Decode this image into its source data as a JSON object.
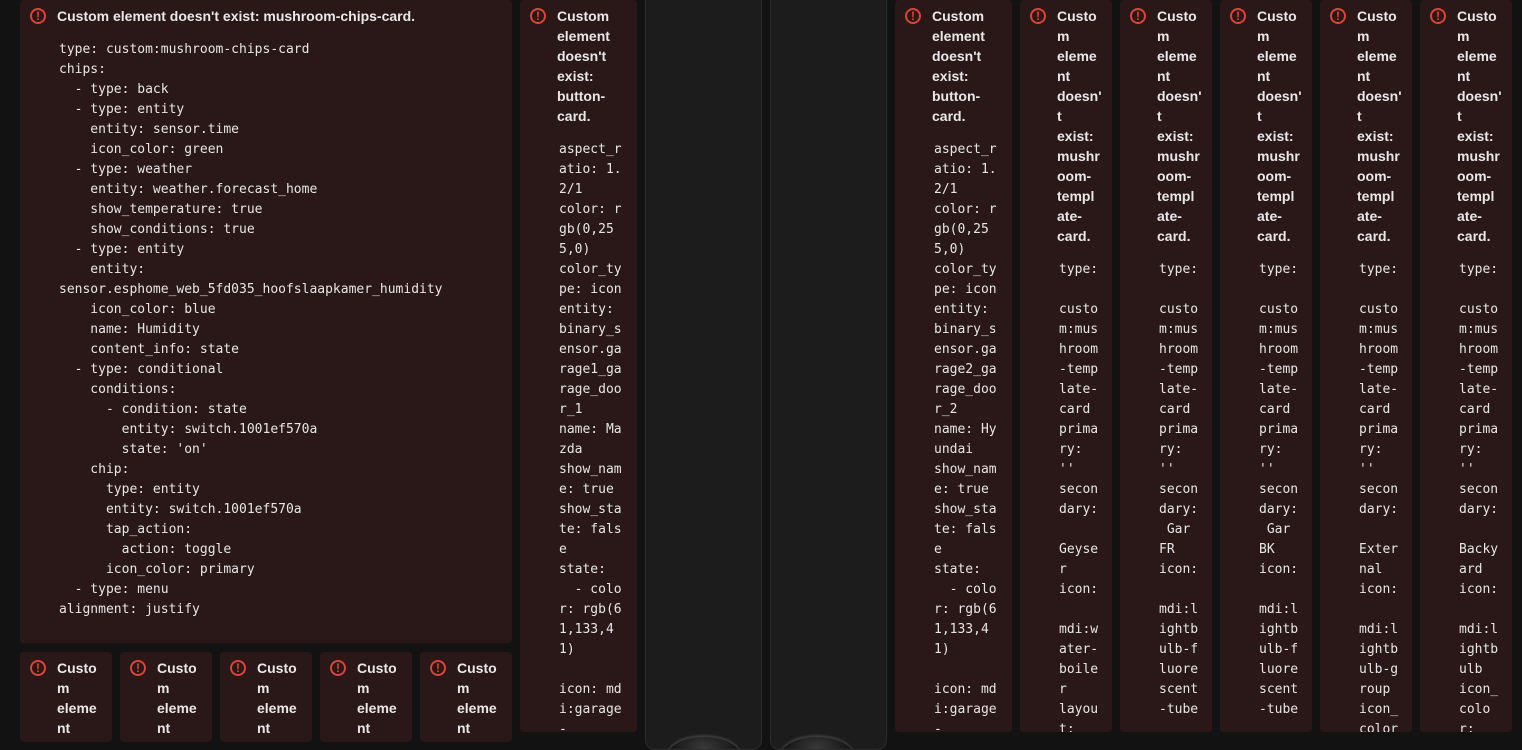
{
  "icons": {
    "error": "error-circle-icon",
    "error_glyph": "!"
  },
  "colors": {
    "background": "#121212",
    "card_bg": "#2a1818",
    "error_red": "#db4437",
    "text": "#e6e6e6"
  },
  "main_card": {
    "title": "Custom element doesn't exist: mushroom-chips-card.",
    "code": "type: custom:mushroom-chips-card\nchips:\n  - type: back\n  - type: entity\n    entity: sensor.time\n    icon_color: green\n  - type: weather\n    entity: weather.forecast_home\n    show_temperature: true\n    show_conditions: true\n  - type: entity\n    entity:\nsensor.esphome_web_5fd035_hoofslaapkamer_humidity\n    icon_color: blue\n    name: Humidity\n    content_info: state\n  - type: conditional\n    conditions:\n      - condition: state\n        entity: switch.1001ef570a\n        state: 'on'\n    chip:\n      type: entity\n      entity: switch.1001ef570a\n      tap_action:\n        action: toggle\n      icon_color: primary\n  - type: menu\nalignment: justify"
  },
  "button_card_1": {
    "title": "Custom element doesn't exist: button-card.",
    "code": "aspect_ratio: 1.2/1\ncolor: rgb(0,255,0)\ncolor_type: icon\nentity: binary_sensor.garage1_garage_door_1\nname: Mazda\nshow_name: true\nshow_state: false\nstate:\n  - color: rgb(61,133,41)\n\nicon: mdi:garage-"
  },
  "button_card_2": {
    "title": "Custom element doesn't exist: button-card.",
    "code": "aspect_ratio: 1.2/1\ncolor: rgb(0,255,0)\ncolor_type: icon\nentity: binary_sensor.garage2_garage_door_2\nname: Hyundai\nshow_name: true\nshow_state: false\nstate:\n  - color: rgb(61,133,41)\n\nicon: mdi:garage-"
  },
  "template_cards": [
    {
      "title": "Custom element doesn't exist: mushroom-template-card.",
      "code": "type:\n\ncustom:mushroom-template-card primary: ''\nsecondary:\n\nGeyser\nicon:\n\nmdi:water-boiler\nlayout:"
    },
    {
      "title": "Custom element doesn't exist: mushroom-template-card.",
      "code": "type:\n\ncustom:mushroom-template-card primary: ''\nsecondary:\n Gar FR\nicon:\n\nmdi:lightbulb-fluorescent-tube"
    },
    {
      "title": "Custom element doesn't exist: mushroom-template-card.",
      "code": "type:\n\ncustom:mushroom-template-card primary: ''\nsecondary:\n Gar BK\nicon:\n\nmdi:lightbulb-fluorescent-tube"
    },
    {
      "title": "Custom element doesn't exist: mushroom-template-card.",
      "code": "type:\n\ncustom:mushroom-template-card primary: ''\nsecondary:\n\nExternal\nicon:\n\nmdi:lightbulb-group\nicon_color"
    },
    {
      "title": "Custom element doesn't exist: mushroom-template-card.",
      "code": "type:\n\ncustom:mushroom-template-card primary: ''\nsecondary:\n\nBackyard\nicon:\n\nmdi:lightbulb\nicon_color:"
    }
  ],
  "bottom_cards": [
    {
      "title": "Custom element doesn't exist"
    },
    {
      "title": "Custom element doesn't exist"
    },
    {
      "title": "Custom element doesn't exist"
    },
    {
      "title": "Custom element doesn't exist"
    },
    {
      "title": "Custom element doesn't exist"
    }
  ]
}
